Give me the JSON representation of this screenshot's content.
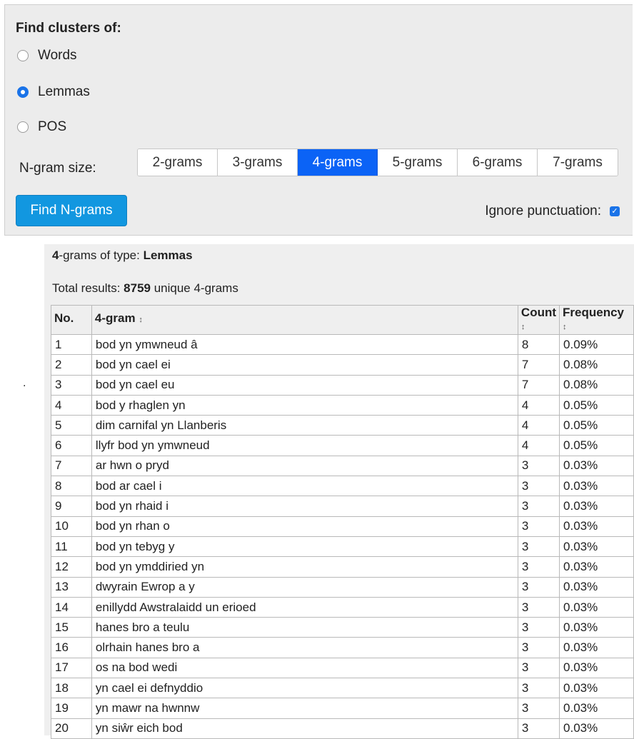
{
  "settings": {
    "title": "Find clusters of:",
    "options": [
      {
        "label": "Words",
        "selected": false
      },
      {
        "label": "Lemmas",
        "selected": true
      },
      {
        "label": "POS",
        "selected": false
      }
    ],
    "ngram_label": "N-gram size:",
    "ngram_sizes": [
      "2-grams",
      "3-grams",
      "4-grams",
      "5-grams",
      "6-grams",
      "7-grams"
    ],
    "active_size": "4-grams",
    "find_button": "Find N-grams",
    "ignore_punctuation_label": "Ignore punctuation:",
    "ignore_punctuation_checked": true
  },
  "stray_mark": ".",
  "results": {
    "type_prefix_bold": "4",
    "type_prefix": "-grams of type: ",
    "type_value": "Lemmas",
    "total_prefix": "Total results: ",
    "total_value": "8759",
    "total_suffix": " unique 4-grams",
    "headers": {
      "no": "No.",
      "gram": "4-gram",
      "count": "Count",
      "frequency": "Frequency"
    },
    "sort_glyph": "↕",
    "rows": [
      [
        "1",
        "bod yn ymwneud â",
        "8",
        "0.09%"
      ],
      [
        "2",
        "bod yn cael ei",
        "7",
        "0.08%"
      ],
      [
        "3",
        "bod yn cael eu",
        "7",
        "0.08%"
      ],
      [
        "4",
        "bod y rhaglen yn",
        "4",
        "0.05%"
      ],
      [
        "5",
        "dim carnifal yn Llanberis",
        "4",
        "0.05%"
      ],
      [
        "6",
        "llyfr bod yn ymwneud",
        "4",
        "0.05%"
      ],
      [
        "7",
        "ar hwn o pryd",
        "3",
        "0.03%"
      ],
      [
        "8",
        "bod ar cael i",
        "3",
        "0.03%"
      ],
      [
        "9",
        "bod yn rhaid i",
        "3",
        "0.03%"
      ],
      [
        "10",
        "bod yn rhan o",
        "3",
        "0.03%"
      ],
      [
        "11",
        "bod yn tebyg y",
        "3",
        "0.03%"
      ],
      [
        "12",
        "bod yn ymddiried yn",
        "3",
        "0.03%"
      ],
      [
        "13",
        "dwyrain Ewrop a y",
        "3",
        "0.03%"
      ],
      [
        "14",
        "enillydd Awstralaidd un erioed",
        "3",
        "0.03%"
      ],
      [
        "15",
        "hanes bro a teulu",
        "3",
        "0.03%"
      ],
      [
        "16",
        "olrhain hanes bro a",
        "3",
        "0.03%"
      ],
      [
        "17",
        "os na bod wedi",
        "3",
        "0.03%"
      ],
      [
        "18",
        "yn cael ei defnyddio",
        "3",
        "0.03%"
      ],
      [
        "19",
        "yn mawr na hwnnw",
        "3",
        "0.03%"
      ],
      [
        "20",
        "yn siŵr eich bod",
        "3",
        "0.03%"
      ]
    ]
  }
}
